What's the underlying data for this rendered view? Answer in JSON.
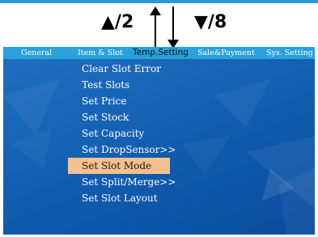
{
  "hints": {
    "up": "▲/2",
    "down": "▼/8"
  },
  "tabs": [
    {
      "label": "General"
    },
    {
      "label": "Item & Slot"
    },
    {
      "label": "Temp.Setting"
    },
    {
      "label": "Sale&Payment"
    },
    {
      "label": "Sys. Setting"
    }
  ],
  "menu": {
    "items": [
      {
        "label": "Clear Slot Error"
      },
      {
        "label": "Test Slots"
      },
      {
        "label": "Set Price"
      },
      {
        "label": "Set Stock"
      },
      {
        "label": "Set Capacity"
      },
      {
        "label": "Set DropSensor>>"
      },
      {
        "label": "Set Slot Mode"
      },
      {
        "label": "Set Split/Merge>>"
      },
      {
        "label": "Set Slot Layout"
      }
    ],
    "selected_label": "Set Slot Mode"
  },
  "colors": {
    "tabbar": "#2aa0dc",
    "screen_bg": "#1764b6",
    "selected_bg": "#f5c18e",
    "top_strip": "#2a9bd0"
  }
}
